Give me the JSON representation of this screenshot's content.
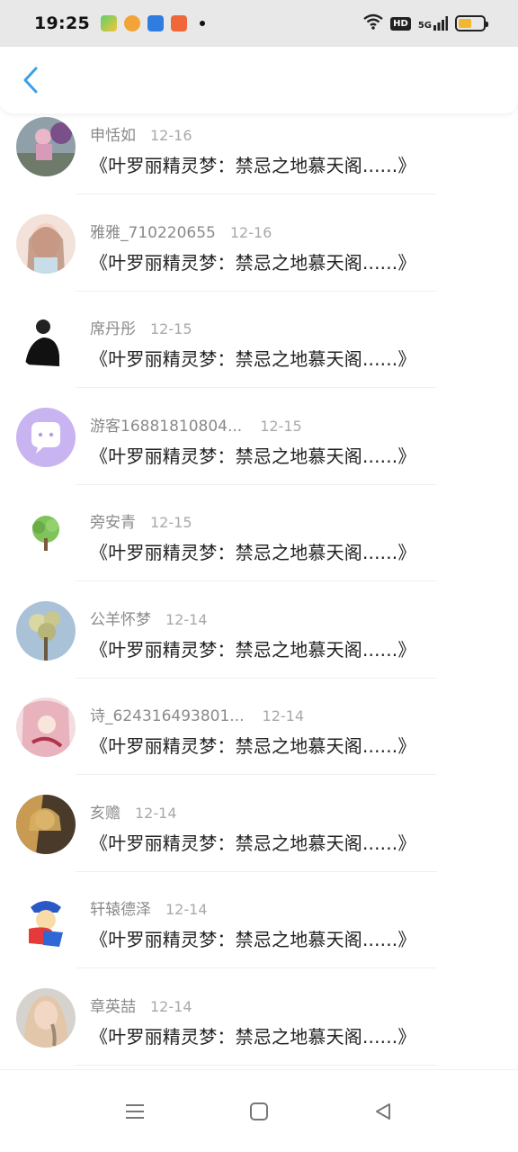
{
  "status_bar": {
    "time": "19:25",
    "hd_label": "HD",
    "signal_label": "5G",
    "battery_color": "#f2b630"
  },
  "nav": {
    "back_icon": "chevron-left-icon",
    "accent_color": "#3aa0e8"
  },
  "comments": [
    {
      "name": "申恬如",
      "date": "12-16",
      "title": "《叶罗丽精灵梦：禁忌之地慕天阁......》"
    },
    {
      "name": "雅雅_710220655",
      "date": "12-16",
      "title": "《叶罗丽精灵梦：禁忌之地慕天阁......》"
    },
    {
      "name": "席丹彤",
      "date": "12-15",
      "title": "《叶罗丽精灵梦：禁忌之地慕天阁......》"
    },
    {
      "name": "游客16881810804...",
      "date": "12-15",
      "title": "《叶罗丽精灵梦：禁忌之地慕天阁......》"
    },
    {
      "name": "旁安青",
      "date": "12-15",
      "title": "《叶罗丽精灵梦：禁忌之地慕天阁......》"
    },
    {
      "name": "公羊怀梦",
      "date": "12-14",
      "title": "《叶罗丽精灵梦：禁忌之地慕天阁......》"
    },
    {
      "name": "诗_624316493801...",
      "date": "12-14",
      "title": "《叶罗丽精灵梦：禁忌之地慕天阁......》"
    },
    {
      "name": "亥赡",
      "date": "12-14",
      "title": "《叶罗丽精灵梦：禁忌之地慕天阁......》"
    },
    {
      "name": "轩辕德泽",
      "date": "12-14",
      "title": "《叶罗丽精灵梦：禁忌之地慕天阁......》"
    },
    {
      "name": "章英喆",
      "date": "12-14",
      "title": "《叶罗丽精灵梦：禁忌之地慕天阁......》"
    }
  ],
  "bottom_nav": {
    "menu_icon": "menu-icon",
    "home_icon": "home-square-icon",
    "back_icon": "back-triangle-icon"
  }
}
